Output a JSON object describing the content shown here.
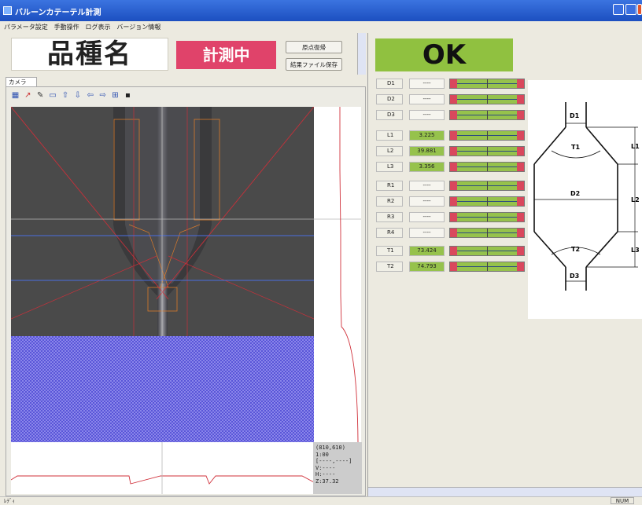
{
  "window": {
    "title": "バルーンカテーテル計測"
  },
  "menu": [
    "パラメータ設定",
    "手動操作",
    "ログ表示",
    "バージョン情報"
  ],
  "header": {
    "product_name": "品種名",
    "status": "計測中",
    "origin_button": "原点復帰",
    "save_button": "結果ファイル保存"
  },
  "camera": {
    "tab_label": "カメラ",
    "toolbar_icons": [
      "grid-icon",
      "pen-icon",
      "pencil-icon",
      "ruler-icon",
      "arrow-up-icon",
      "arrow-down-icon",
      "arrow-left-icon",
      "arrow-right-icon",
      "grid-select-icon",
      "save-icon"
    ],
    "readout": [
      "(810,610)",
      "1:00",
      "[----,----]",
      "V:----",
      "H:----",
      "Z:37.32"
    ]
  },
  "result": {
    "text": "OK"
  },
  "measurements": [
    {
      "label": "D1",
      "value": "----"
    },
    {
      "label": "D2",
      "value": "----"
    },
    {
      "label": "D3",
      "value": "----"
    },
    {
      "label": "L1",
      "value": "3.225"
    },
    {
      "label": "L2",
      "value": "39.881"
    },
    {
      "label": "L3",
      "value": "3.356"
    },
    {
      "label": "R1",
      "value": "----"
    },
    {
      "label": "R2",
      "value": "----"
    },
    {
      "label": "R3",
      "value": "----"
    },
    {
      "label": "R4",
      "value": "----"
    },
    {
      "label": "T1",
      "value": "73.424"
    },
    {
      "label": "T2",
      "value": "74.793"
    }
  ],
  "diagram": {
    "labels": {
      "d1": "D1",
      "t1": "T1",
      "d2": "D2",
      "t2": "T2",
      "d3": "D3",
      "l1": "L1",
      "l2": "L2",
      "l3": "L3"
    }
  },
  "statusbar": {
    "left": "ﾚﾃﾞｨ",
    "right": "NUM"
  },
  "colors": {
    "ok": "#90c140",
    "measuring": "#e0436a",
    "bar_limit": "#d9485d",
    "titlebar": "#2a5fd6"
  }
}
